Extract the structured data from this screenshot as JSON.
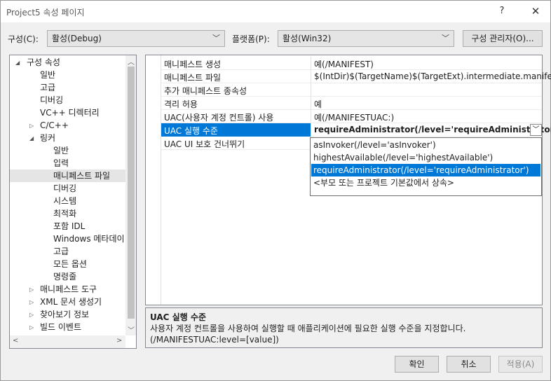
{
  "window": {
    "title": "Project5 속성 페이지",
    "help": "?",
    "close": "✕"
  },
  "config": {
    "config_label": "구성(C):",
    "config_value": "활성(Debug)",
    "platform_label": "플랫폼(P):",
    "platform_value": "활성(Win32)",
    "manager_button": "구성 관리자(O)..."
  },
  "tree": {
    "root": "구성 속성",
    "items": [
      "일반",
      "고급",
      "디버깅",
      "VC++ 디렉터리",
      "C/C++",
      "링커",
      "일반",
      "입력",
      "매니페스트 파일",
      "디버깅",
      "시스템",
      "최적화",
      "포함 IDL",
      "Windows 메타데이",
      "고급",
      "모든 옵션",
      "명령줄",
      "매니페스트 도구",
      "XML 문서 생성기",
      "찾아보기 정보",
      "빌드 이벤트"
    ]
  },
  "grid": {
    "rows": [
      {
        "name": "매니페스트 생성",
        "value": "예(/MANIFEST)"
      },
      {
        "name": "매니페스트 파일",
        "value": "$(IntDir)$(TargetName)$(TargetExt).intermediate.manifest"
      },
      {
        "name": "추가 매니페스트 종속성",
        "value": ""
      },
      {
        "name": "격리 허용",
        "value": "예"
      },
      {
        "name": "UAC(사용자 계정 컨트롤) 사용",
        "value": "예(/MANIFESTUAC:)"
      },
      {
        "name": "UAC 실행 수준",
        "value": "requireAdministrator(/level='requireAdministrator')"
      },
      {
        "name": "UAC UI 보호 건너뛰기",
        "value": ""
      }
    ]
  },
  "dropdown": {
    "options": [
      "asInvoker(/level='asInvoker')",
      "highestAvailable(/level='highestAvailable')",
      "requireAdministrator(/level='requireAdministrator')",
      "<부모 또는 프로젝트 기본값에서 상속>"
    ],
    "selected_index": 2
  },
  "description": {
    "title": "UAC 실행 수준",
    "line1": "사용자 계정 컨트롤을 사용하여 실행할 때 애플리케이션에 필요한 실행 수준을 지정합니다.",
    "line2": "(/MANIFESTUAC:level=[value])"
  },
  "buttons": {
    "ok": "확인",
    "cancel": "취소",
    "apply": "적용(A)"
  },
  "colors": {
    "accent": "#0078d7",
    "selection_gray": "#e5e5e5"
  }
}
